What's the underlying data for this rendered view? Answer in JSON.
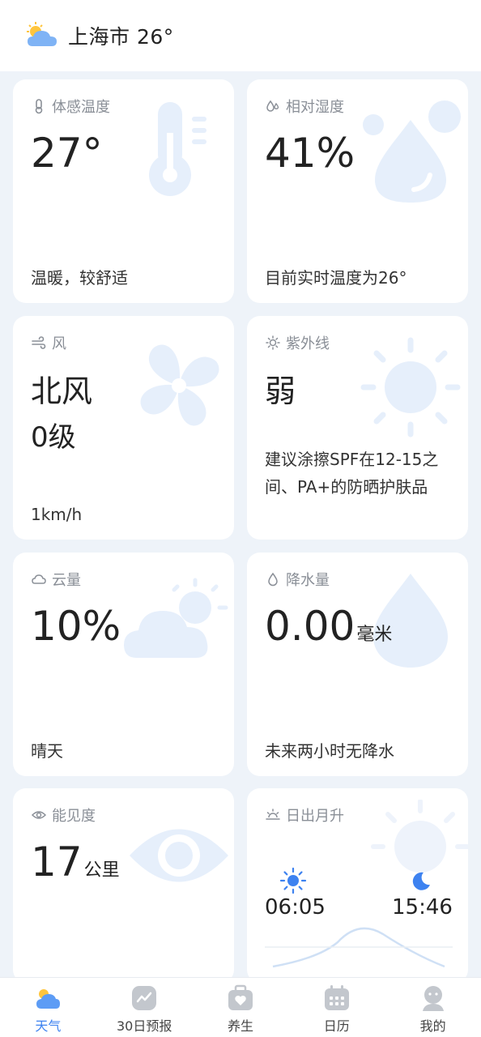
{
  "header": {
    "title": "上海市 26°",
    "weather_icon": "cloudy-sun-icon"
  },
  "cards": {
    "feels_like": {
      "label": "体感温度",
      "value": "27°",
      "desc": "温暖，较舒适"
    },
    "humidity": {
      "label": "相对湿度",
      "value": "41%",
      "desc": "目前实时温度为26°"
    },
    "wind": {
      "label": "风",
      "direction": "北风",
      "level": "0级",
      "speed": "1km/h"
    },
    "uv": {
      "label": "紫外线",
      "value": "弱",
      "desc": "建议涂擦SPF在12-15之间、PA+的防晒护肤品"
    },
    "cloud": {
      "label": "云量",
      "value": "10%",
      "desc": "晴天"
    },
    "rain": {
      "label": "降水量",
      "value": "0.00",
      "unit": "毫米",
      "desc": "未来两小时无降水"
    },
    "visibility": {
      "label": "能见度",
      "value": "17",
      "unit": "公里"
    },
    "sun": {
      "label": "日出月升",
      "sunrise": "06:05",
      "moonrise": "15:46"
    }
  },
  "tabs": [
    {
      "label": "天气",
      "icon": "weather-icon",
      "active": true
    },
    {
      "label": "30日预报",
      "icon": "trend-icon",
      "active": false
    },
    {
      "label": "养生",
      "icon": "health-bag-icon",
      "active": false
    },
    {
      "label": "日历",
      "icon": "calendar-icon",
      "active": false
    },
    {
      "label": "我的",
      "icon": "profile-icon",
      "active": false
    }
  ],
  "colors": {
    "accent": "#3d82f0",
    "background": "#eef3f9",
    "icon_faint": "#e3edfb"
  }
}
